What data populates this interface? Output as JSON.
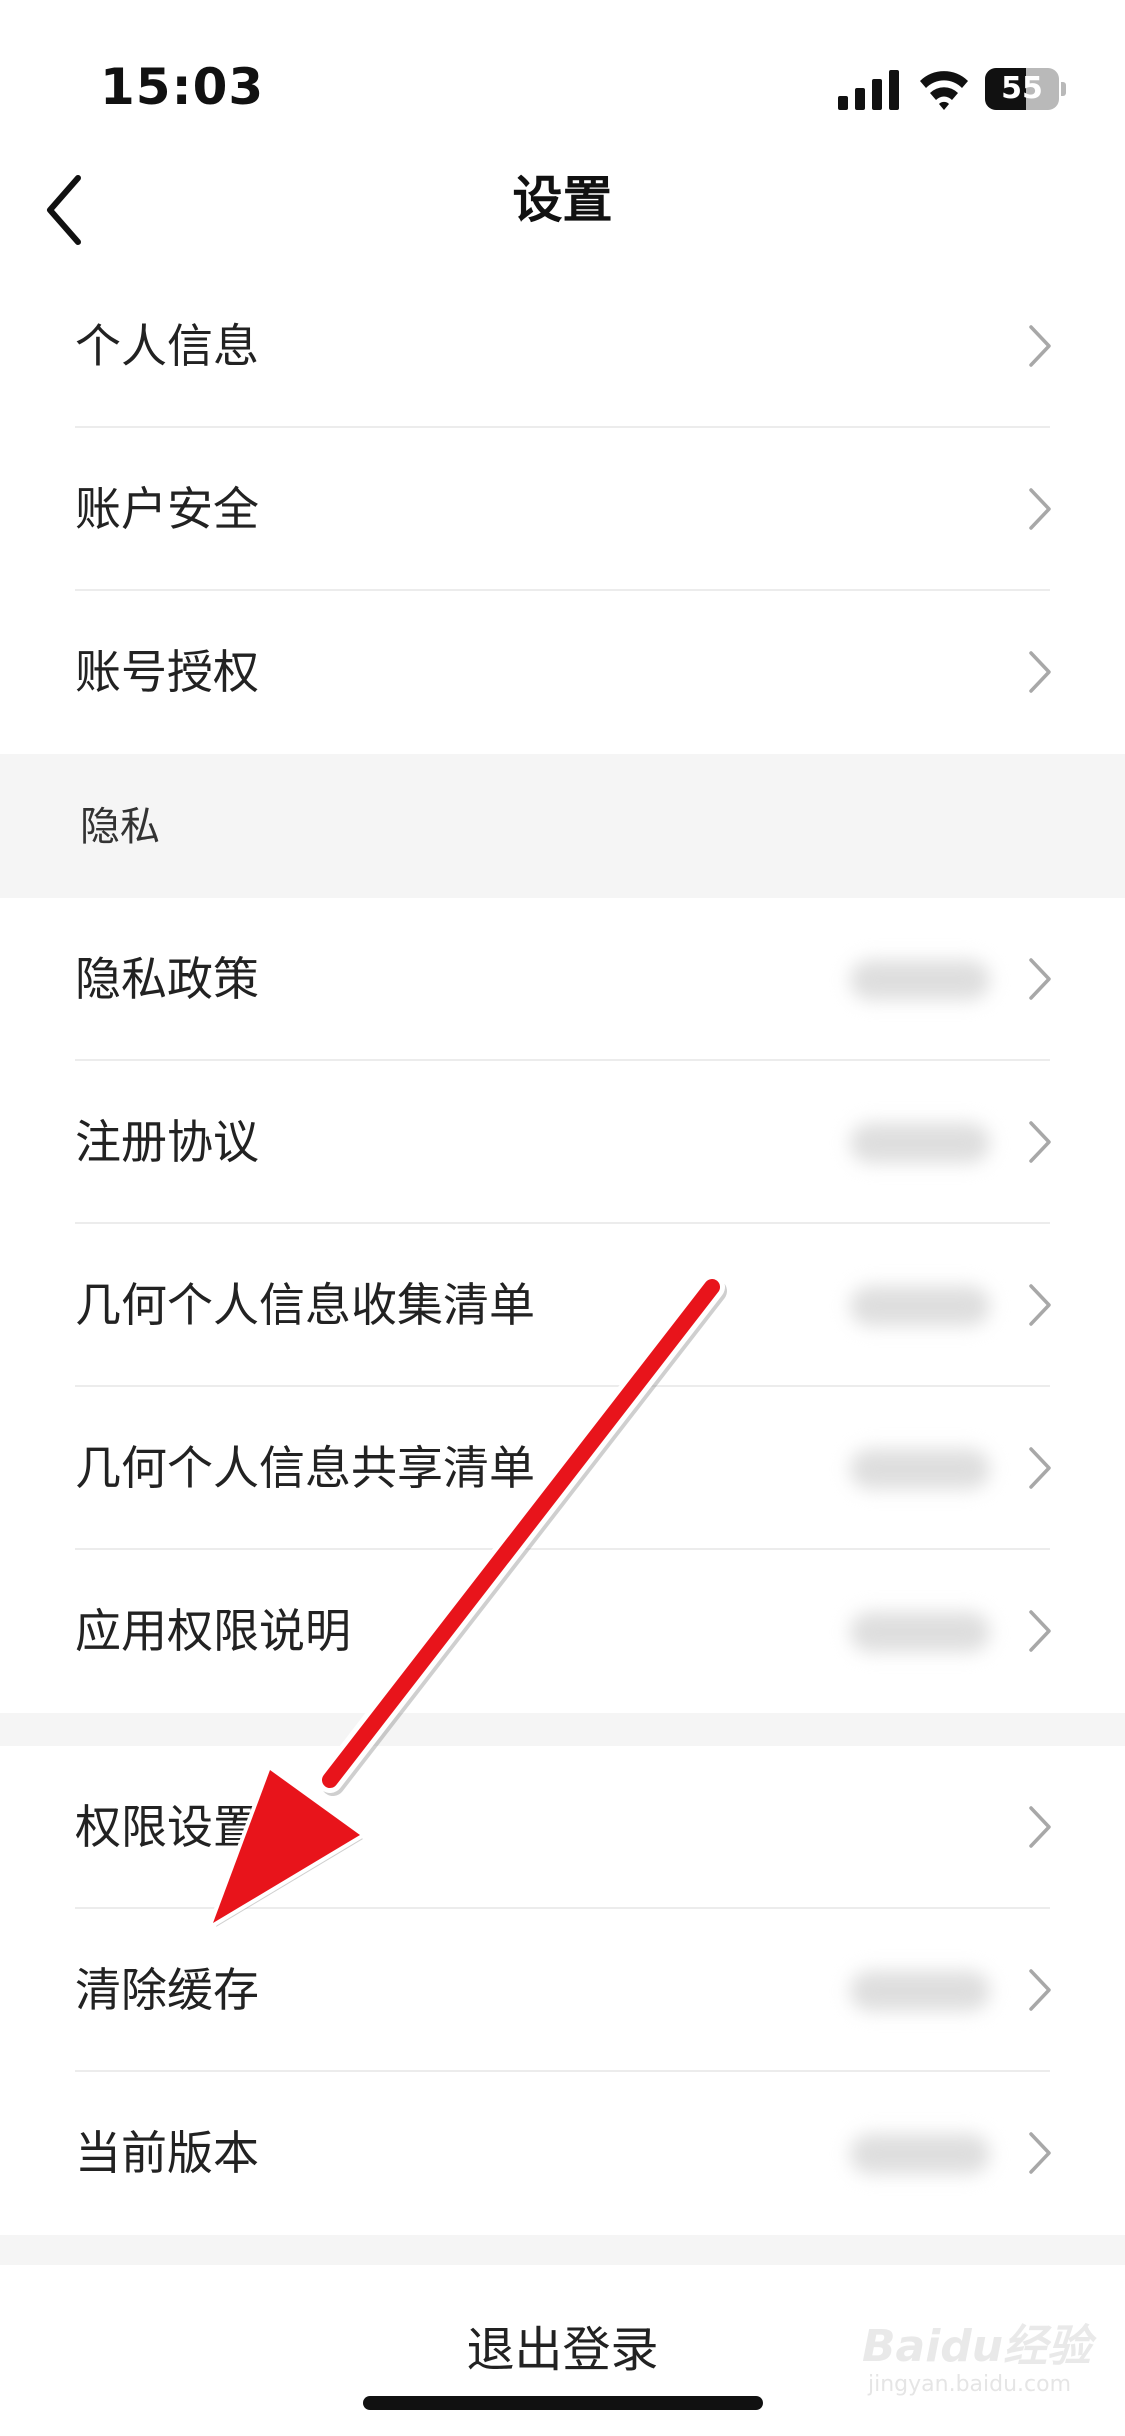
{
  "status_bar": {
    "time": "15:03",
    "battery": "55",
    "battery_level": 0.55
  },
  "nav": {
    "title": "设置",
    "back_icon": "chevron-left-icon"
  },
  "group_account": {
    "items": [
      {
        "label": "个人信息"
      },
      {
        "label": "账户安全"
      },
      {
        "label": "账号授权"
      }
    ]
  },
  "section_privacy": {
    "title": "隐私"
  },
  "group_privacy": {
    "items": [
      {
        "label": "隐私政策"
      },
      {
        "label": "注册协议"
      },
      {
        "label": "几何个人信息收集清单"
      },
      {
        "label": "几何个人信息共享清单"
      },
      {
        "label": "应用权限说明"
      }
    ]
  },
  "group_general": {
    "items": [
      {
        "label": "权限设置"
      },
      {
        "label": "清除缓存"
      },
      {
        "label": "当前版本"
      }
    ]
  },
  "logout": {
    "label": "退出登录"
  },
  "watermark": {
    "text": "Baidu经验",
    "sub": "jingyan.baidu.com"
  },
  "annotation": {
    "color": "#e8141b",
    "icon": "red-arrow-annotation"
  }
}
